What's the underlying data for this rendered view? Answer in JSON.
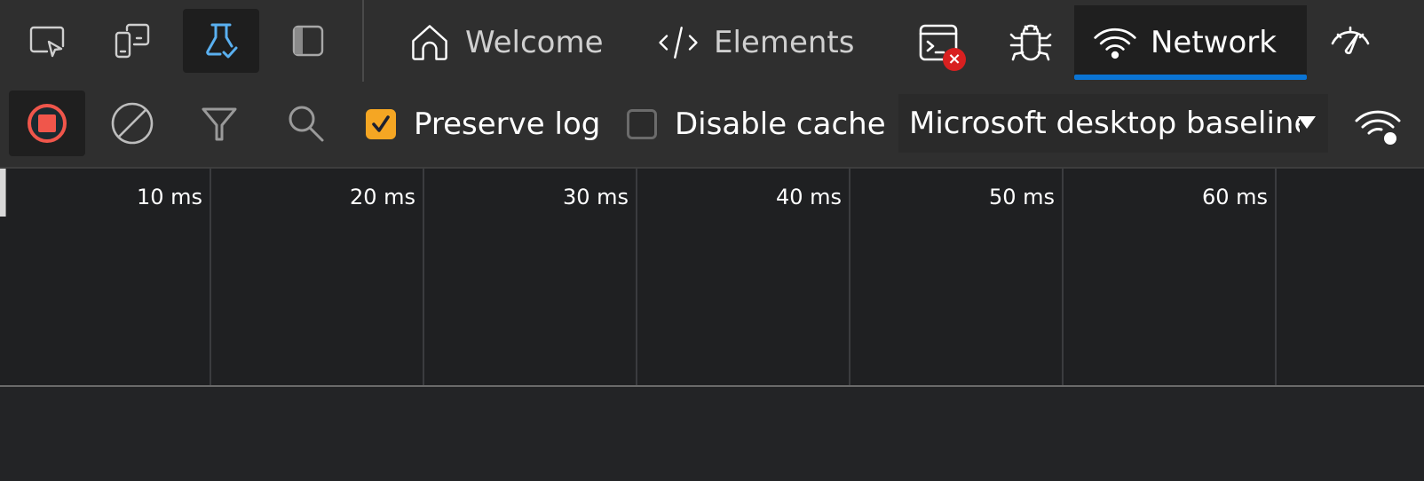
{
  "tabbar": {
    "icons": [
      {
        "name": "inspect-element-icon",
        "active": false
      },
      {
        "name": "device-emulation-icon",
        "active": false
      },
      {
        "name": "experiments-flask-icon",
        "active": true
      },
      {
        "name": "dock-side-icon",
        "active": false
      }
    ],
    "tabs": [
      {
        "id": "welcome",
        "label": "Welcome",
        "icon": "home-icon",
        "active": false
      },
      {
        "id": "elements",
        "label": "Elements",
        "icon": "code-icon",
        "active": false
      },
      {
        "id": "console",
        "label": "",
        "icon": "console-icon",
        "badge": "error",
        "active": false
      },
      {
        "id": "sources",
        "label": "",
        "icon": "bug-icon",
        "active": false
      },
      {
        "id": "network",
        "label": "Network",
        "icon": "wifi-icon",
        "active": true
      },
      {
        "id": "performance",
        "label": "",
        "icon": "performance-gauge-icon",
        "active": false
      }
    ],
    "accent_color": "#0a74d4"
  },
  "toolbar": {
    "record_button": {
      "icon": "stop-recording-icon",
      "state": "recording",
      "color": "#f0564b"
    },
    "clear_button": {
      "icon": "clear-icon"
    },
    "filter_button": {
      "icon": "filter-icon"
    },
    "search_button": {
      "icon": "search-icon"
    },
    "preserve_log": {
      "label": "Preserve log",
      "checked": true,
      "color": "#f5a623"
    },
    "disable_cache": {
      "label": "Disable cache",
      "checked": false
    },
    "throttling": {
      "selected": "Microsoft desktop baseline",
      "icon": "caret-down-icon"
    },
    "network_conditions_icon": "network-conditions-icon"
  },
  "timeline": {
    "ticks": [
      "10 ms",
      "20 ms",
      "30 ms",
      "40 ms",
      "50 ms",
      "60 ms"
    ]
  }
}
